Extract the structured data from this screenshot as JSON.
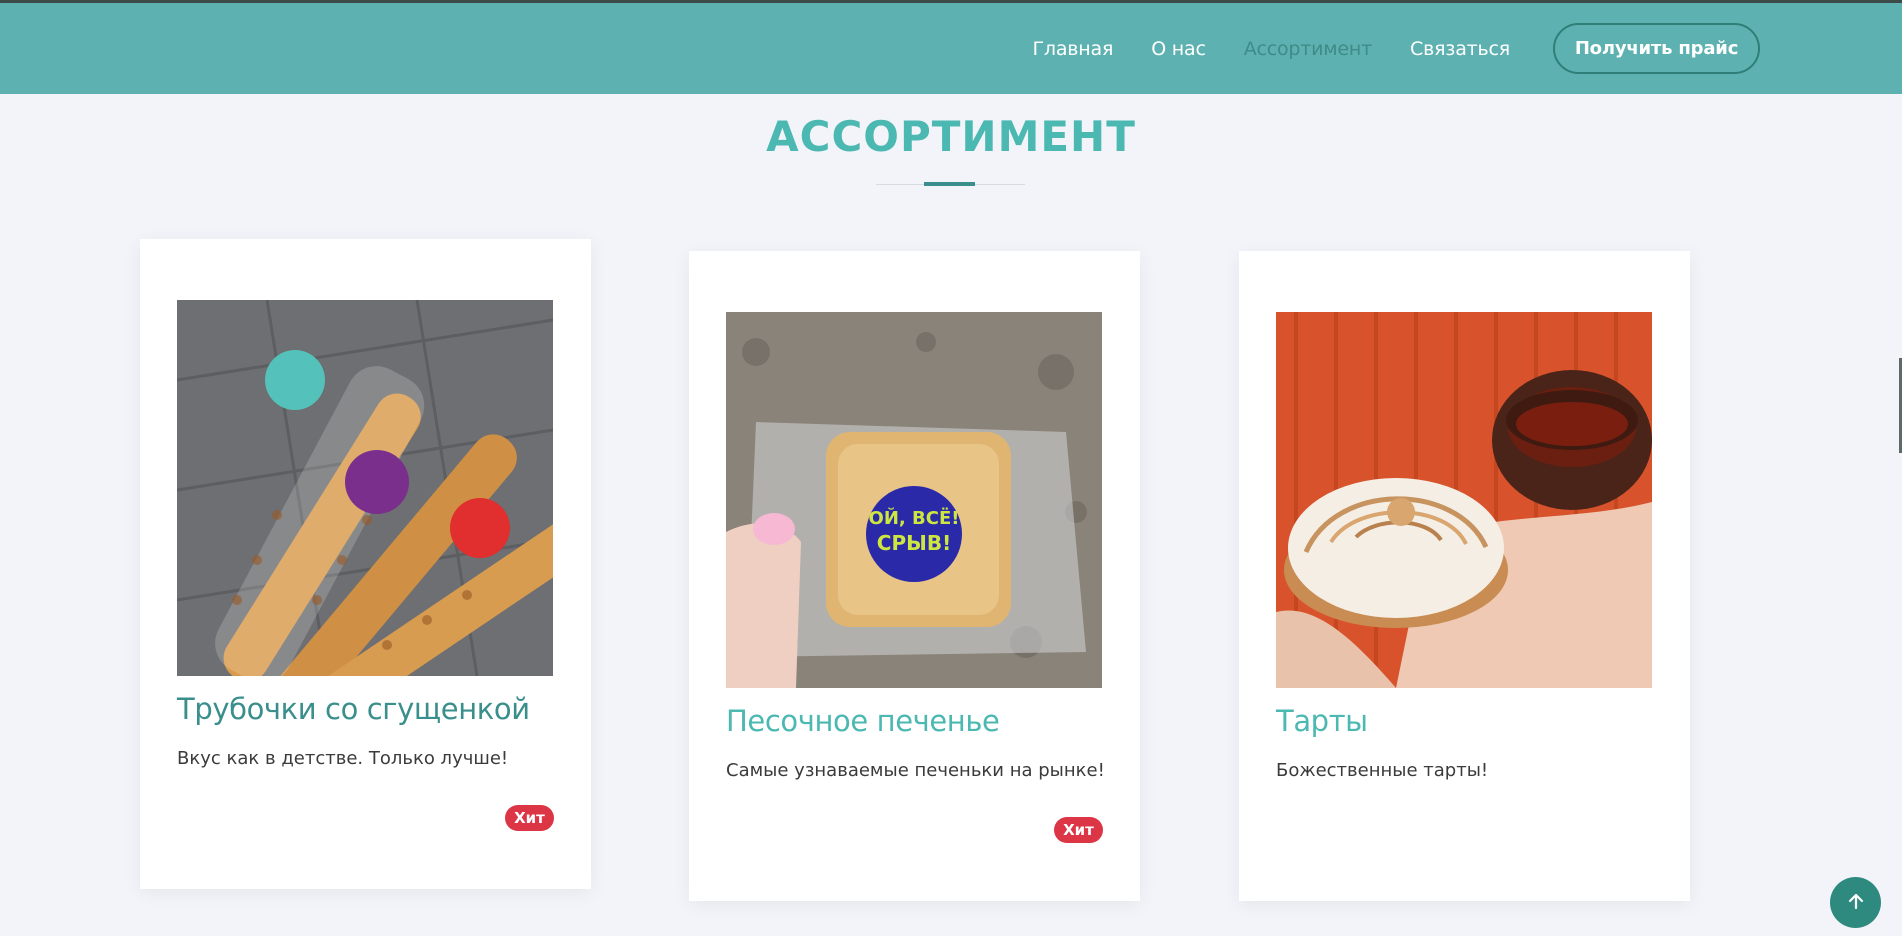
{
  "nav": {
    "items": [
      {
        "label": "Главная",
        "active": false
      },
      {
        "label": "О нас",
        "active": false
      },
      {
        "label": "Ассортимент",
        "active": true
      },
      {
        "label": "Связаться",
        "active": false
      }
    ],
    "cta_label": "Получить прайс"
  },
  "section": {
    "title": "АССОРТИМЕНТ"
  },
  "products": [
    {
      "title": "Трубочки со сгущенкой",
      "description": "Вкус как в детстве. Только лучше!",
      "badge": "Хит",
      "image_icon": "wafer-rolls-photo"
    },
    {
      "title": "Песочное печенье",
      "description": "Самые узнаваемые печеньки на рынке!",
      "badge": "Хит",
      "image_icon": "shortbread-cookie-photo",
      "sticker_text": "ОЙ, ВСЁ! СРЫВ!"
    },
    {
      "title": "Тарты",
      "description": "Божественные тарты!",
      "badge": "",
      "image_icon": "tarts-photo"
    }
  ],
  "colors": {
    "header_bg": "#5db2b1",
    "accent": "#4cb8b2",
    "title_dark": "#3a8f8c",
    "badge": "#dc3545",
    "page_bg": "#f2f4f9"
  },
  "icons": {
    "scroll_top": "arrow-up-icon"
  }
}
